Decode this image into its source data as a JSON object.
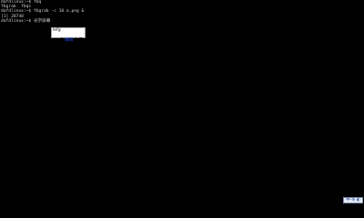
{
  "terminal": {
    "lines": [
      "dafdlinux:~$ fbq",
      "fbgrab  fbqs",
      "dafdlinux:~$ fbgrab -c 10 a.png &",
      "[1] 28748",
      "dafdlinux:~$ 光学屏幕"
    ]
  },
  "ime": {
    "preedit": "lefg",
    "candidates": [
      {
        "index": "1.",
        "text": "咖啡"
      },
      {
        "index": "2.",
        "text": "是"
      }
    ],
    "selected": 0
  },
  "tray": {
    "label": "中·英 ◐"
  }
}
